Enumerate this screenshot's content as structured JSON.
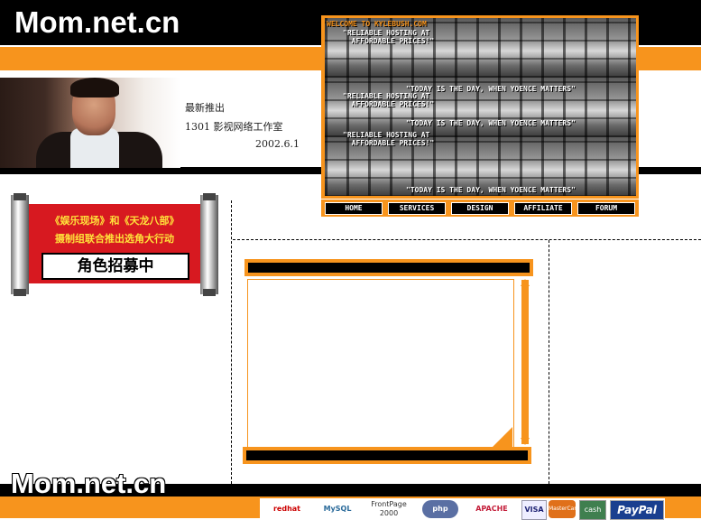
{
  "header": {
    "logo": "Mom.net.cn"
  },
  "intro": {
    "line1": "最新推出",
    "line2": "1301 影视网络工作室",
    "line3": "2002.6.1"
  },
  "banner": {
    "welcome": "WELCOME TO KYLEBUSH.COM",
    "quote1": "\"RELIABLE HOSTING AT\n  AFFORDABLE PRICES!\"",
    "quote2": "\"TODAY IS THE DAY, WHEN YOENCE MATTERS\""
  },
  "nav": {
    "items": [
      "HOME",
      "SERVICES",
      "DESIGN",
      "AFFILIATE",
      "FORUM"
    ]
  },
  "ad": {
    "line1": "《娱乐现场》和《天龙八部》",
    "line2": "摄制组联合推出选角大行动",
    "cta": "角色招募中"
  },
  "footer": {
    "logo": "Mom.net.cn",
    "badges": [
      "redhat",
      "MySQL",
      "FrontPage 2000",
      "php",
      "APACHE",
      "VISA",
      "MasterCard",
      "cash",
      "PayPal"
    ]
  },
  "colors": {
    "accent": "#f7941d",
    "dark": "#000000",
    "ad_red": "#d71920"
  }
}
